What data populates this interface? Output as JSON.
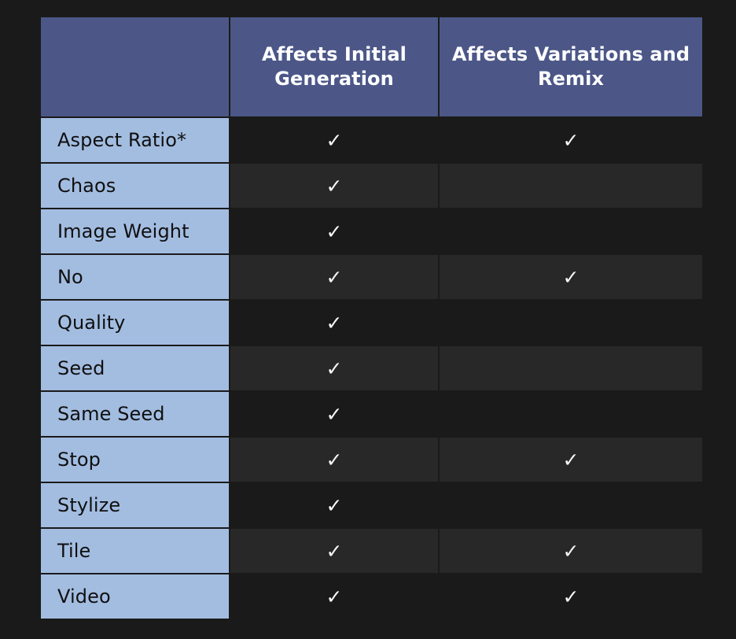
{
  "table": {
    "corner_label": "",
    "columns": [
      {
        "key": "label",
        "header": ""
      },
      {
        "key": "initial",
        "header": "Affects Initial Generation"
      },
      {
        "key": "variations",
        "header": "Affects Variations and Remix"
      }
    ],
    "check_glyph": "✓",
    "colors": {
      "page_background": "#1a1a1a",
      "header_blue": "#4c5788",
      "row_label_blue": "#a3bde1",
      "cell_dark": "#1a1a1a",
      "cell_dark_alt": "#282828",
      "header_text": "#ffffff",
      "label_text": "#101010",
      "check_color": "#f6f6f6"
    },
    "rows": [
      {
        "label": "Aspect Ratio*",
        "initial": "✓",
        "variations": "✓"
      },
      {
        "label": "Chaos",
        "initial": "✓",
        "variations": ""
      },
      {
        "label": "Image Weight",
        "initial": "✓",
        "variations": ""
      },
      {
        "label": "No",
        "initial": "✓",
        "variations": "✓"
      },
      {
        "label": "Quality",
        "initial": "✓",
        "variations": ""
      },
      {
        "label": "Seed",
        "initial": "✓",
        "variations": ""
      },
      {
        "label": "Same Seed",
        "initial": "✓",
        "variations": ""
      },
      {
        "label": "Stop",
        "initial": "✓",
        "variations": "✓"
      },
      {
        "label": "Stylize",
        "initial": "✓",
        "variations": ""
      },
      {
        "label": "Tile",
        "initial": "✓",
        "variations": "✓"
      },
      {
        "label": "Video",
        "initial": "✓",
        "variations": "✓"
      }
    ]
  }
}
